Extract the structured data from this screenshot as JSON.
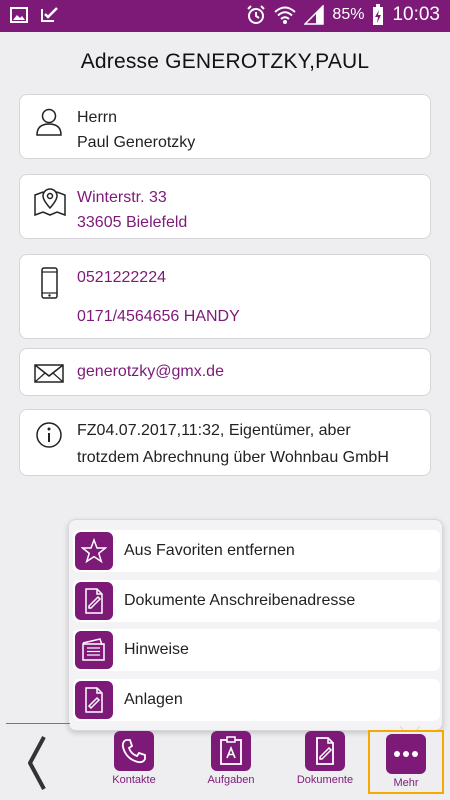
{
  "status_bar": {
    "battery_percent": "85%",
    "time": "10:03"
  },
  "title": "Adresse GENEROTZKY,PAUL",
  "contact": {
    "salutation": "Herrn",
    "name": "Paul Generotzky",
    "street": "Winterstr. 33",
    "city": "33605 Bielefeld",
    "phone1": "0521222224",
    "phone2": "0171/4564656 HANDY",
    "email": "generotzky@gmx.de",
    "note_line1": "FZ04.07.2017,11:32, Eigentümer, aber",
    "note_line2": "trotzdem Abrechnung über Wohnbau GmbH"
  },
  "menu": {
    "items": [
      {
        "label": "Aus Favoriten entfernen",
        "icon": "star-icon"
      },
      {
        "label": "Dokumente Anschreibenadresse",
        "icon": "document-edit-icon"
      },
      {
        "label": "Hinweise",
        "icon": "notes-icon"
      },
      {
        "label": "Anlagen",
        "icon": "attachment-icon"
      }
    ]
  },
  "nav": {
    "kontakte": "Kontakte",
    "aufgaben": "Aufgaben",
    "dokumente": "Dokumente",
    "mehr": "Mehr"
  },
  "colors": {
    "accent": "#7d1a78",
    "highlight": "#f5a800"
  }
}
